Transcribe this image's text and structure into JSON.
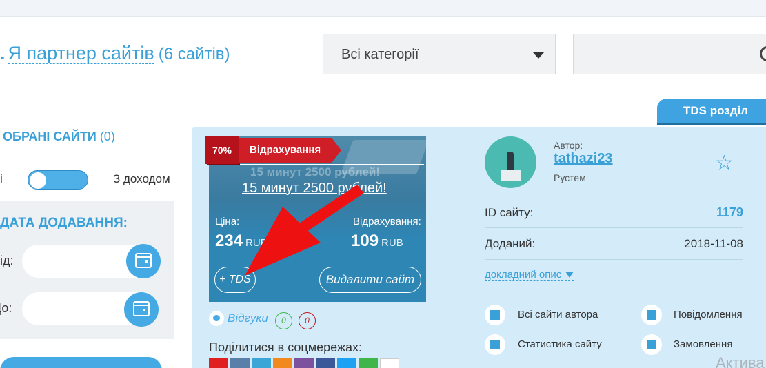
{
  "header": {
    "title_main": "Я партнер сайтів",
    "title_count": "(6 сайтів)",
    "category_select": "Всі категорії",
    "tds_tab": "TDS розділ"
  },
  "sidebar": {
    "favorites_title": "ОБРАНІ САЙТИ",
    "favorites_count": "(0)",
    "toggle_left_label": "і",
    "toggle_right_label": "З доходом",
    "date_title": "ДАТА ДОДАВАННЯ:",
    "from_label": "Від:",
    "to_label": "До:"
  },
  "card": {
    "discount_pct": "70%",
    "badge_label": "Відрахування",
    "thumb_ghost_text": "15 минут 2500 рублей!",
    "site_title": "15 минут 2500 рублей!",
    "price_label": "Ціна:",
    "price_value": "234",
    "price_currency": "RUB",
    "deduction_label": "Відрахування:",
    "deduction_value": "109",
    "deduction_currency": "RUB",
    "add_tds": "+ TDS",
    "delete_site": "Видалити сайт",
    "reviews_label": "Відгуки",
    "reviews_positive": "0",
    "reviews_negative": "0",
    "share_label": "Поділитися в соцмережах:",
    "author_label": "Автор:",
    "author_name": "tathazi23",
    "author_real_name": "Рустем",
    "site_id_label": "ID сайту:",
    "site_id_value": "1179",
    "added_label": "Доданий:",
    "added_value": "2018-11-08",
    "more_description": "докладний опис",
    "actions": {
      "author_sites": "Всі сайти автора",
      "messages": "Повідомлення",
      "statistics": "Статистика сайту",
      "orders": "Замовлення"
    },
    "status_partial": "Актива"
  },
  "colors": {
    "accent": "#3aa0d8",
    "card_bg": "#d4ecf9",
    "badge_red": "#d01e27",
    "thumb_blue": "#2e86b5",
    "arrow_red": "#ee1111"
  },
  "icons": [
    "search-icon",
    "calendar-icon",
    "star-icon",
    "home-icon",
    "mail-icon",
    "chart-icon",
    "cart-icon",
    "chat-bubble-icon"
  ]
}
